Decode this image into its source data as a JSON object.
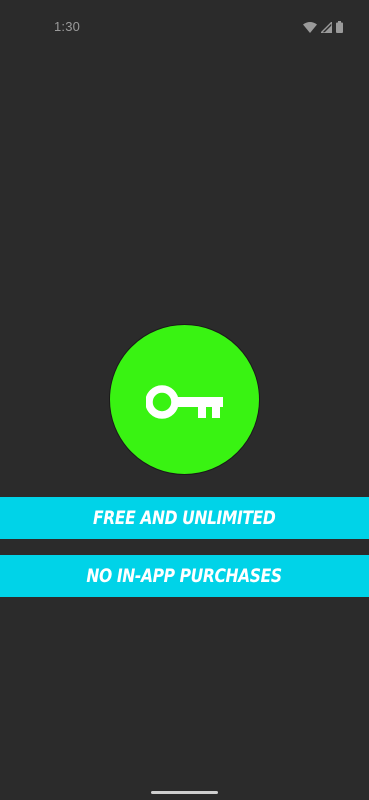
{
  "status_bar": {
    "time": "1:30",
    "icons": [
      "wifi-icon",
      "cellular-signal-icon",
      "battery-icon"
    ]
  },
  "logo": {
    "icon": "key-icon",
    "background_color": "#39f312",
    "icon_color": "#ffffff"
  },
  "banners": [
    {
      "text": "FREE AND UNLIMITED"
    },
    {
      "text": "NO IN-APP PURCHASES"
    }
  ],
  "colors": {
    "background": "#2b2b2b",
    "banner": "#00d3e8",
    "banner_text": "#ffffff"
  }
}
